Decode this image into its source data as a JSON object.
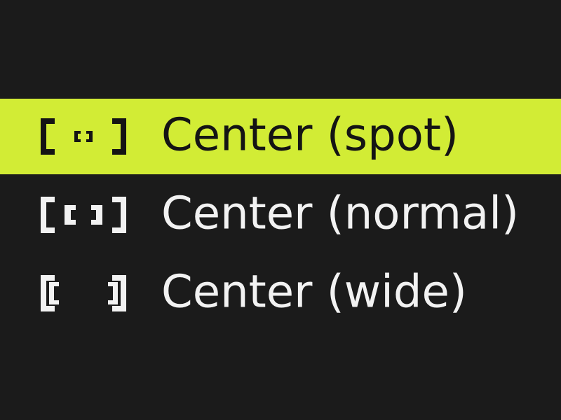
{
  "colors": {
    "background": "#1b1b1b",
    "highlight": "#d2ec35",
    "text": "#f2f2f2",
    "selected_text": "#141414"
  },
  "menu": {
    "items": [
      {
        "label": "Center (spot)",
        "icon": "af-center-spot-icon",
        "selected": true
      },
      {
        "label": "Center (normal)",
        "icon": "af-center-normal-icon",
        "selected": false
      },
      {
        "label": "Center (wide)",
        "icon": "af-center-wide-icon",
        "selected": false
      }
    ]
  }
}
